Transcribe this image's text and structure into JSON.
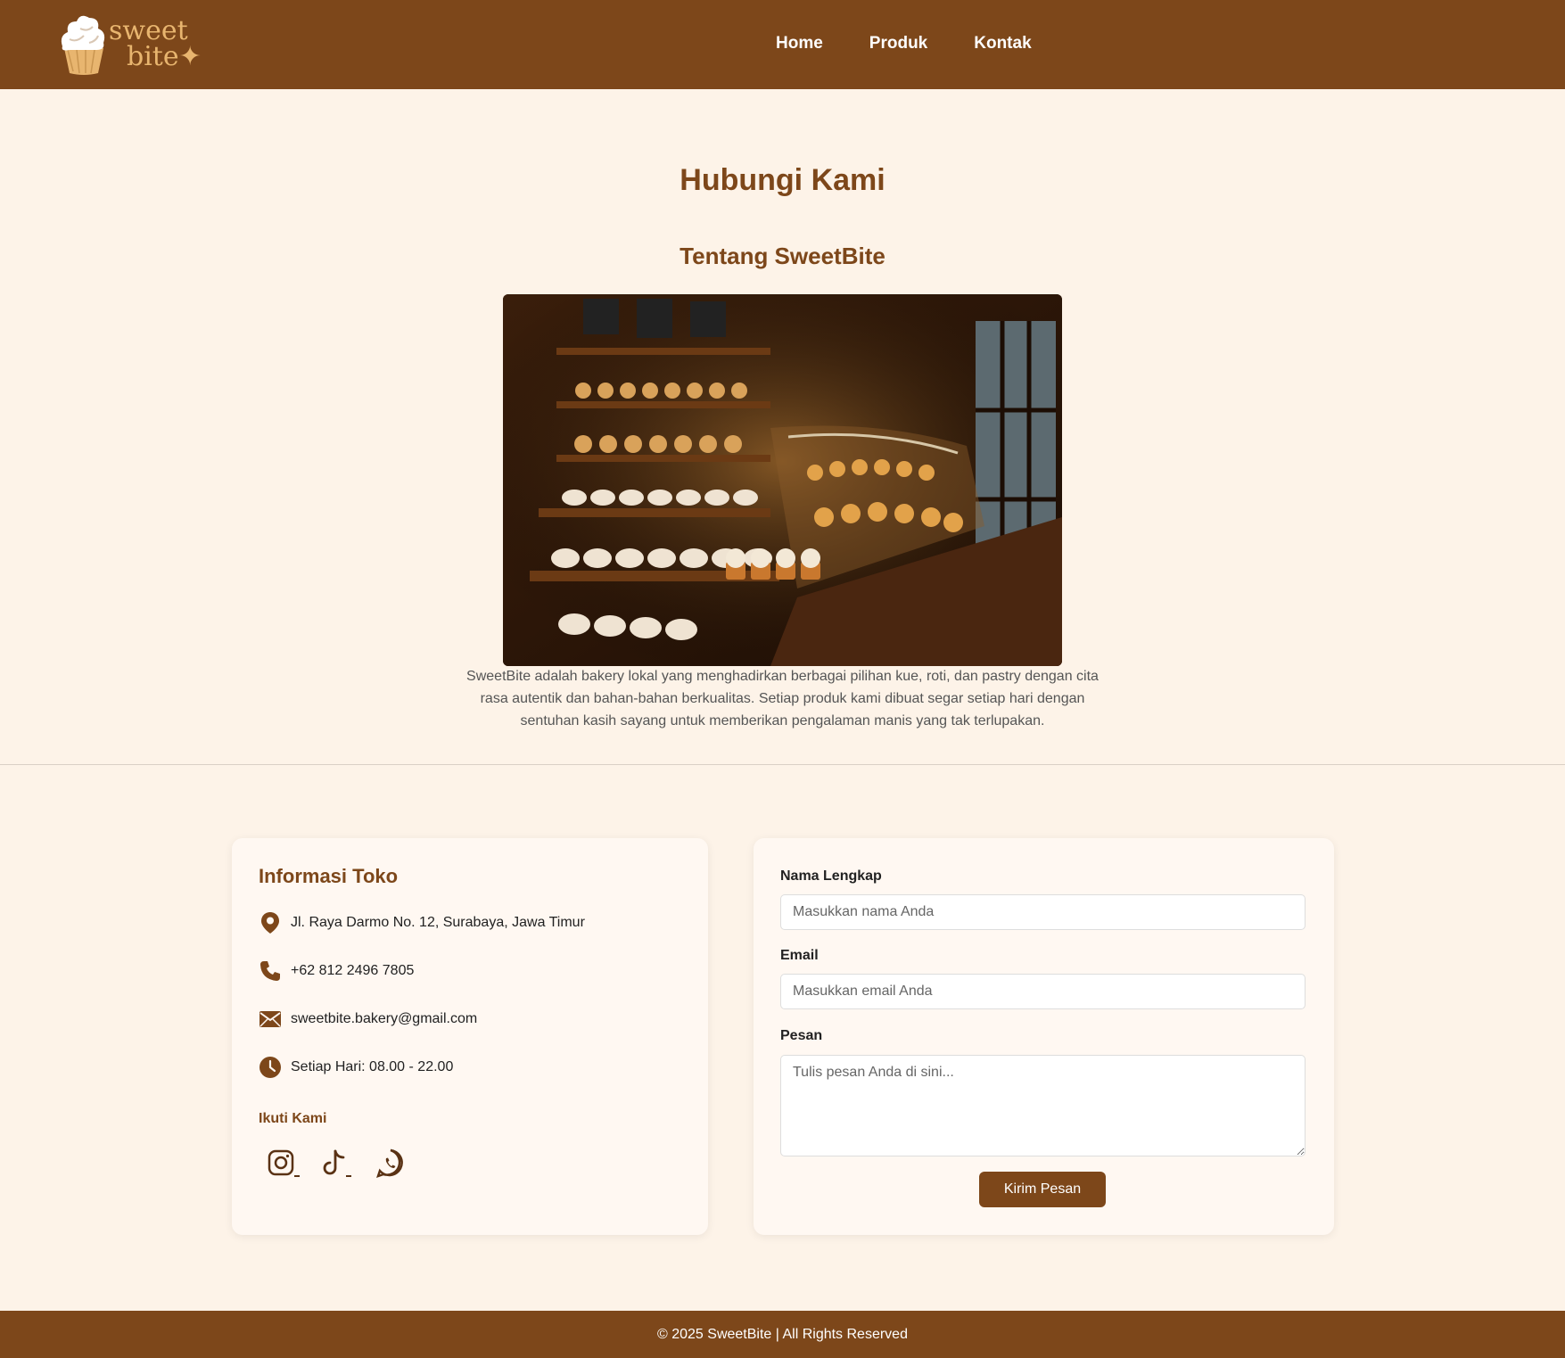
{
  "header": {
    "logo": {
      "line1": "sweet",
      "line2": "bite"
    },
    "nav": [
      {
        "label": "Home"
      },
      {
        "label": "Produk"
      },
      {
        "label": "Kontak"
      }
    ]
  },
  "main": {
    "title": "Hubungi Kami",
    "about_title": "Tentang SweetBite",
    "about_text": "SweetBite adalah bakery lokal yang menghadirkan berbagai pilihan kue, roti, dan pastry dengan cita rasa autentik dan bahan-bahan berkualitas. Setiap produk kami dibuat segar setiap hari dengan sentuhan kasih sayang untuk memberikan pengalaman manis yang tak terlupakan."
  },
  "info": {
    "title": "Informasi Toko",
    "address": "Jl. Raya Darmo No. 12, Surabaya, Jawa Timur",
    "phone": "+62 812 2496 7805",
    "email": "sweetbite.bakery@gmail.com",
    "hours": "Setiap Hari: 08.00 - 22.00",
    "follow_title": "Ikuti Kami",
    "icons": [
      "location-icon",
      "phone-icon",
      "mail-icon",
      "clock-icon"
    ],
    "socials": [
      "instagram-icon",
      "tiktok-icon",
      "whatsapp-icon"
    ]
  },
  "form": {
    "name_label": "Nama Lengkap",
    "name_placeholder": "Masukkan nama Anda",
    "email_label": "Email",
    "email_placeholder": "Masukkan email Anda",
    "message_label": "Pesan",
    "message_placeholder": "Tulis pesan Anda di sini...",
    "submit_label": "Kirim Pesan"
  },
  "footer": {
    "text": "© 2025 SweetBite | All Rights Reserved"
  },
  "colors": {
    "brand": "#7d471a",
    "background": "#fdf3e8",
    "accent": "#e8b56f"
  }
}
